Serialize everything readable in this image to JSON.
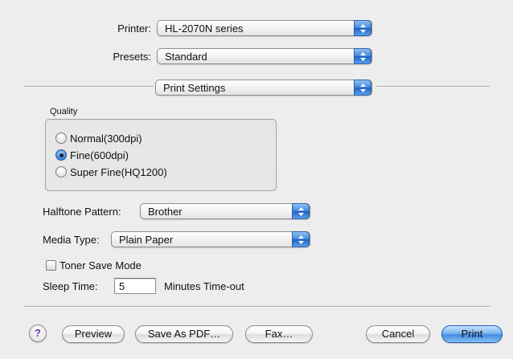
{
  "printer": {
    "label": "Printer:",
    "value": "HL-2070N series"
  },
  "presets": {
    "label": "Presets:",
    "value": "Standard"
  },
  "panel": {
    "value": "Print Settings"
  },
  "quality": {
    "title": "Quality",
    "options": [
      {
        "label": "Normal(300dpi)",
        "selected": false
      },
      {
        "label": "Fine(600dpi)",
        "selected": true
      },
      {
        "label": "Super Fine(HQ1200)",
        "selected": false
      }
    ]
  },
  "halftone": {
    "label": "Halftone Pattern:",
    "value": "Brother"
  },
  "media_type": {
    "label": "Media Type:",
    "value": "Plain Paper"
  },
  "toner_save": {
    "label": "Toner Save Mode",
    "checked": false
  },
  "sleep_time": {
    "label": "Sleep Time:",
    "value": "5",
    "suffix": "Minutes Time-out"
  },
  "buttons": {
    "help": "?",
    "preview": "Preview",
    "save_pdf": "Save As PDF…",
    "fax": "Fax…",
    "cancel": "Cancel",
    "print": "Print"
  },
  "colors": {
    "accent": "#3f86dc",
    "help_glyph": "#6b2fb0"
  }
}
